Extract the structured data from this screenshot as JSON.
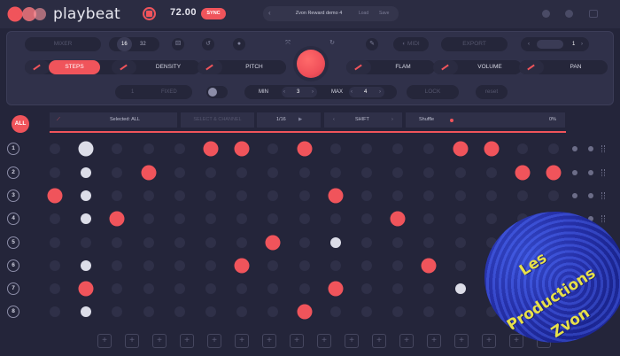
{
  "app": {
    "name": "playbeat",
    "bpm": "72.00",
    "sync_label": "SYNC"
  },
  "preset": {
    "name": "Zvon Reward demo 4",
    "left_arrow": "‹",
    "right_arrow": "›",
    "btn_a": "Load",
    "btn_b": "Save"
  },
  "panel": {
    "mixer_label": "MIXER",
    "steps_a": "16",
    "steps_b": "32",
    "export_label": "EXPORT",
    "pager_value": "1",
    "params": [
      {
        "label": "STEPS",
        "active": true
      },
      {
        "label": "DENSITY",
        "active": false
      },
      {
        "label": "PITCH",
        "active": false
      },
      {
        "label": "FLAM",
        "active": false
      },
      {
        "label": "VOLUME",
        "active": false
      },
      {
        "label": "PAN",
        "active": false
      }
    ],
    "fixed_a": "1",
    "fixed_b": "FIXED",
    "min_label": "MIN",
    "min_value": "3",
    "max_label": "MAX",
    "max_value": "4",
    "lock_label": "LOCK",
    "reset_label": "reset"
  },
  "toolbar": {
    "all_label": "ALL",
    "selected_label": "Selected: ALL",
    "select_label": "SELECT & CHANNEL",
    "rate": "1/16",
    "shift_label": "SHIFT",
    "shuffle_label": "Shuffle",
    "shuffle_value": "0%"
  },
  "rows": [
    "1",
    "2",
    "3",
    "4",
    "5",
    "6",
    "7",
    "8"
  ],
  "pattern": [
    [
      {
        "c": 1,
        "t": "white",
        "big": true
      },
      {
        "c": 5,
        "t": "red"
      },
      {
        "c": 6,
        "t": "red"
      },
      {
        "c": 8,
        "t": "red"
      },
      {
        "c": 13,
        "t": "red"
      },
      {
        "c": 14,
        "t": "red"
      }
    ],
    [
      {
        "c": 1,
        "t": "white"
      },
      {
        "c": 3,
        "t": "red"
      },
      {
        "c": 15,
        "t": "red"
      },
      {
        "c": 16,
        "t": "red"
      }
    ],
    [
      {
        "c": 0,
        "t": "red"
      },
      {
        "c": 1,
        "t": "white"
      },
      {
        "c": 9,
        "t": "red"
      }
    ],
    [
      {
        "c": 1,
        "t": "white"
      },
      {
        "c": 2,
        "t": "red"
      },
      {
        "c": 11,
        "t": "red"
      }
    ],
    [
      {
        "c": 7,
        "t": "red"
      },
      {
        "c": 9,
        "t": "white"
      }
    ],
    [
      {
        "c": 1,
        "t": "white"
      },
      {
        "c": 6,
        "t": "red"
      },
      {
        "c": 12,
        "t": "red"
      }
    ],
    [
      {
        "c": 1,
        "t": "red"
      },
      {
        "c": 9,
        "t": "red"
      },
      {
        "c": 13,
        "t": "white"
      }
    ],
    [
      {
        "c": 1,
        "t": "white"
      },
      {
        "c": 8,
        "t": "red"
      }
    ]
  ],
  "watermark": {
    "line1": "Les",
    "line2": "Productions",
    "line3": "Zvon"
  },
  "colors": {
    "accent": "#f0545b",
    "bg": "#24253a",
    "panel": "#30314a"
  }
}
